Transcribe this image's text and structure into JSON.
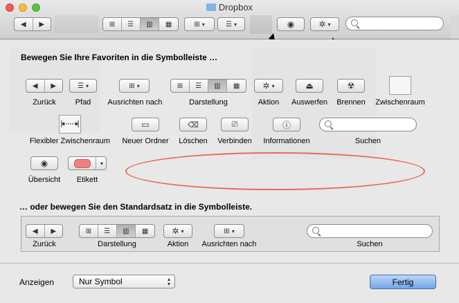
{
  "window": {
    "title": "Dropbox"
  },
  "icons": {
    "back": "◀",
    "forward": "▶",
    "eye": "◉",
    "gear": "✲",
    "dropdown": "▾",
    "eject": "⏏",
    "burn": "☢",
    "trash": "🗑",
    "info": "ⓘ",
    "popup_arrows": "▴▾"
  },
  "sheet": {
    "heading_favorites": "Bewegen Sie Ihre Favoriten in die Symbolleiste …",
    "items": {
      "zurueck": "Zurück",
      "pfad": "Pfad",
      "ausrichten": "Ausrichten nach",
      "darstellung": "Darstellung",
      "aktion": "Aktion",
      "auswerfen": "Auswerfen",
      "brennen": "Brennen",
      "zwischenraum": "Zwischenraum",
      "flexibler": "Flexibler Zwischenraum",
      "neuer_ordner": "Neuer Ordner",
      "loeschen": "Löschen",
      "verbinden": "Verbinden",
      "informationen": "Informationen",
      "suchen": "Suchen",
      "uebersicht": "Übersicht",
      "etikett": "Etikett"
    },
    "heading_default": "… oder bewegen Sie den Standardsatz in die Symbolleiste.",
    "default_items": {
      "zurueck": "Zurück",
      "darstellung": "Darstellung",
      "aktion": "Aktion",
      "ausrichten": "Ausrichten nach",
      "suchen": "Suchen"
    },
    "show_label": "Anzeigen",
    "show_value": "Nur Symbol",
    "done_label": "Fertig"
  },
  "colors": {
    "accent": "#6fa6ea",
    "annotation": "#e86a57",
    "label_red": "#f08080"
  }
}
